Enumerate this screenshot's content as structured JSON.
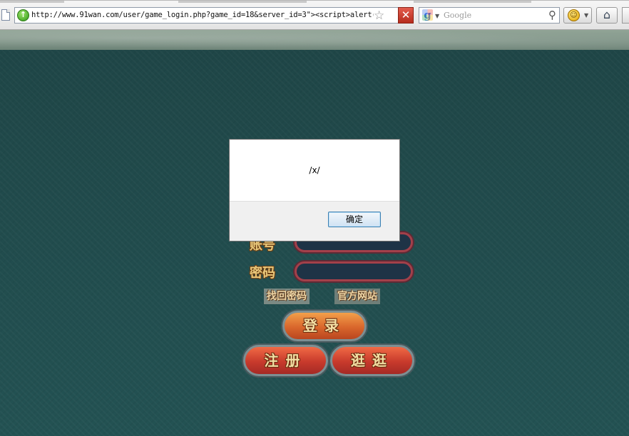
{
  "browser": {
    "url": "http://www.91wan.com/user/game_login.php?game_id=18&server_id=3\"><script>alert(",
    "search_placeholder": "Google",
    "stop_label": "✕",
    "home_label": "⌂"
  },
  "game": {
    "account_label": "账号",
    "password_label": "密码",
    "forgot_password_label": "找回密码",
    "official_site_label": "官方网站",
    "login_label": "登录",
    "register_label": "注册",
    "browse_label": "逛逛"
  },
  "alert": {
    "message": "/x/",
    "ok_label": "确定"
  },
  "colors": {
    "page_background": "#1f4a4b",
    "button_red": "#c83a2c",
    "label_gold": "#e8c77a"
  }
}
